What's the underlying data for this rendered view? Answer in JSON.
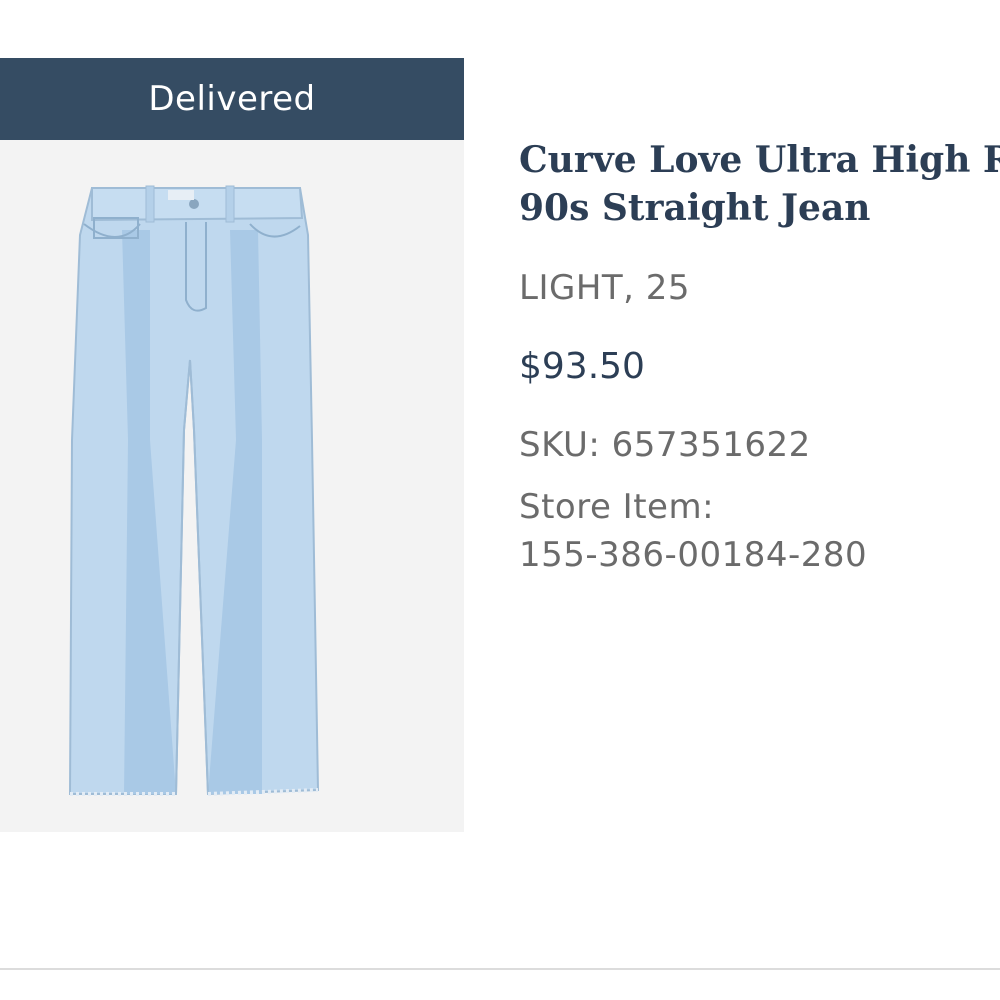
{
  "order_item": {
    "status": "Delivered",
    "title_line1": "Curve Love Ultra High Rise",
    "title_line2": "90s Straight Jean",
    "variant": "LIGHT, 25",
    "price": "$93.50",
    "sku": "SKU: 657351622",
    "store_item_label": "Store Item:",
    "store_item_value": "155-386-00184-280",
    "image_icon": "jeans-product-image"
  },
  "colors": {
    "status_bar": "#354c63",
    "title": "#2c3e55",
    "secondary_text": "#6b6b6b",
    "image_background": "#f3f3f3",
    "denim": "#bcd6ec"
  }
}
